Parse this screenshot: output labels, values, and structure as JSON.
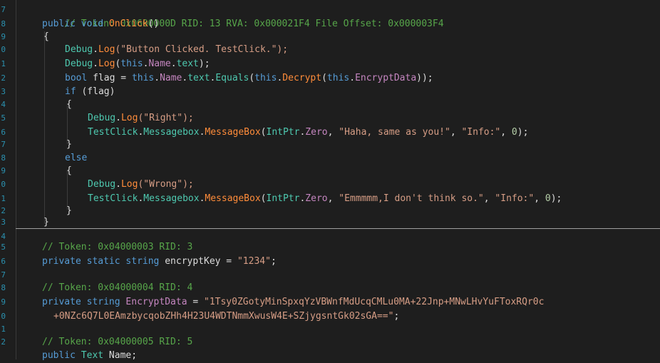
{
  "gutter_numbers": [
    "7",
    "8",
    "9",
    "0",
    "1",
    "2",
    "3",
    "4",
    "5",
    "6",
    "7",
    "8",
    "9",
    "0",
    "1",
    "2",
    "3",
    "4",
    "5",
    "6",
    "7",
    "8",
    "9",
    "0",
    "1",
    "2"
  ],
  "code": {
    "l1_comment": "// Token: 0x0600000D RID: 13 RVA: 0x000021F4 File Offset: 0x000003F4",
    "l2_public": "public",
    "l2_void": "void",
    "l2_method": "OnClick",
    "l2_parens": "()",
    "brace_open": "{",
    "brace_close": "}",
    "debug": "Debug",
    "dot": ".",
    "log": "Log",
    "l4_arg": "(\"Button Clicked. TestClick.\");",
    "this": "this",
    "name": "Name",
    "text": "text",
    "open_paren": "(",
    "close_semi": ");",
    "bool": "bool",
    "flag_assign": " flag = ",
    "equals": "Equals",
    "decrypt": "Decrypt",
    "encryptData_prop": "EncryptData",
    "close2": "));",
    "if": "if",
    "if_cond": " (flag)",
    "right_arg": "(\"Right\");",
    "testclick": "TestClick",
    "messagebox_class": "Messagebox",
    "messagebox_method": "MessageBox",
    "intptr": "IntPtr",
    "zero": "Zero",
    "comma_space": ", ",
    "haha_str": "\"Haha, same as you!\"",
    "info_str": "\"Info:\"",
    "zero_num": "0",
    "else": "else",
    "wrong_arg": "(\"Wrong\");",
    "emm_str": "\"Emmmmm,I don't think so.\"",
    "c2": "// Token: 0x04000003 RID: 3",
    "private": "private",
    "static": "static",
    "string": "string",
    "encryptKey_decl": " encryptKey = ",
    "key_str": "\"1234\"",
    "semi": ";",
    "c3": "// Token: 0x04000004 RID: 4",
    "encryptData_decl": "EncryptData",
    "eq": " = ",
    "data_str1": "\"1Tsy0ZGotyMinSpxqYzVBWnfMdUcqCMLu0MA+22Jnp+MNwLHvYuFToxRQr0c",
    "data_str2": "+0NZc6Q7L0EAmzbycqobZHh4H23U4WDTNmmXwusW4E+SZjygsntGk02sGA==\"",
    "c4": "// Token: 0x04000005 RID: 5",
    "text_type": "Text",
    "name_decl": " Name;"
  }
}
